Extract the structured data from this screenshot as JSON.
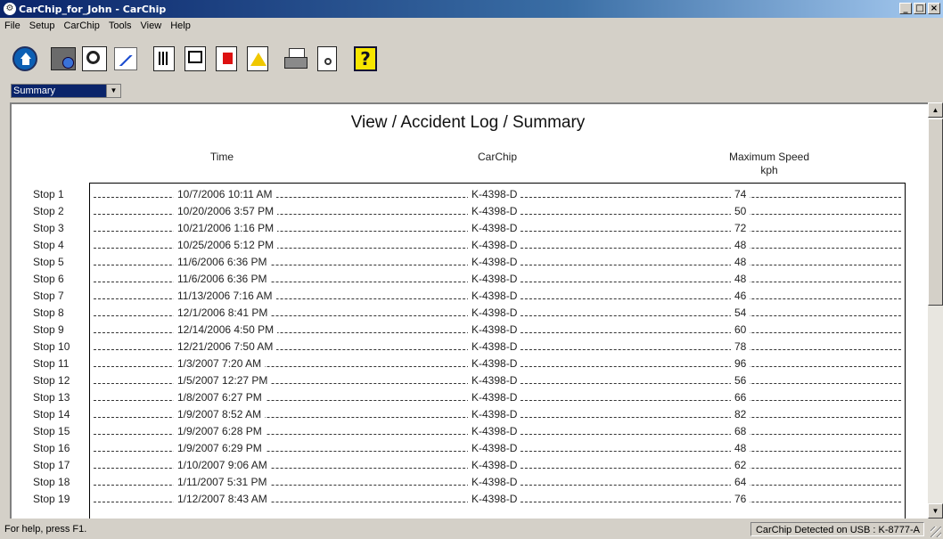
{
  "window": {
    "title": "CarChip_for_John - CarChip",
    "controls": [
      "_",
      "□",
      "×"
    ]
  },
  "menu": [
    "File",
    "Setup",
    "CarChip",
    "Tools",
    "View",
    "Help"
  ],
  "toolbar": {
    "icons": [
      "home-icon",
      "download-chip-icon",
      "view-data-icon",
      "graph-icon",
      "summary-report-icon",
      "window-report-icon",
      "add-report-icon",
      "warning-report-icon",
      "printer-icon",
      "print-preview-icon",
      "help-icon"
    ],
    "help_glyph": "?"
  },
  "view_selector": {
    "value": "Summary"
  },
  "report": {
    "title": "View / Accident Log / Summary",
    "col_time": "Time",
    "col_carchip": "CarChip",
    "col_speed": "Maximum Speed",
    "col_speed_unit": "kph",
    "rows": [
      {
        "stop": "Stop 1",
        "time": "10/7/2006 10:11 AM",
        "chip": "K-4398-D",
        "speed": "74"
      },
      {
        "stop": "Stop 2",
        "time": "10/20/2006 3:57 PM",
        "chip": "K-4398-D",
        "speed": "50"
      },
      {
        "stop": "Stop 3",
        "time": "10/21/2006 1:16 PM",
        "chip": "K-4398-D",
        "speed": "72"
      },
      {
        "stop": "Stop 4",
        "time": "10/25/2006 5:12 PM",
        "chip": "K-4398-D",
        "speed": "48"
      },
      {
        "stop": "Stop 5",
        "time": "11/6/2006 6:36 PM",
        "chip": "K-4398-D",
        "speed": "48"
      },
      {
        "stop": "Stop 6",
        "time": "11/6/2006 6:36 PM",
        "chip": "K-4398-D",
        "speed": "48"
      },
      {
        "stop": "Stop 7",
        "time": "11/13/2006 7:16 AM",
        "chip": "K-4398-D",
        "speed": "46"
      },
      {
        "stop": "Stop 8",
        "time": "12/1/2006 8:41 PM",
        "chip": "K-4398-D",
        "speed": "54"
      },
      {
        "stop": "Stop 9",
        "time": "12/14/2006 4:50 PM",
        "chip": "K-4398-D",
        "speed": "60"
      },
      {
        "stop": "Stop 10",
        "time": "12/21/2006 7:50 AM",
        "chip": "K-4398-D",
        "speed": "78"
      },
      {
        "stop": "Stop 11",
        "time": "1/3/2007 7:20 AM",
        "chip": "K-4398-D",
        "speed": "96"
      },
      {
        "stop": "Stop 12",
        "time": "1/5/2007 12:27 PM",
        "chip": "K-4398-D",
        "speed": "56"
      },
      {
        "stop": "Stop 13",
        "time": "1/8/2007 6:27 PM",
        "chip": "K-4398-D",
        "speed": "66"
      },
      {
        "stop": "Stop 14",
        "time": "1/9/2007 8:52 AM",
        "chip": "K-4398-D",
        "speed": "82"
      },
      {
        "stop": "Stop 15",
        "time": "1/9/2007 6:28 PM",
        "chip": "K-4398-D",
        "speed": "68"
      },
      {
        "stop": "Stop 16",
        "time": "1/9/2007 6:29 PM",
        "chip": "K-4398-D",
        "speed": "48"
      },
      {
        "stop": "Stop 17",
        "time": "1/10/2007 9:06 AM",
        "chip": "K-4398-D",
        "speed": "62"
      },
      {
        "stop": "Stop 18",
        "time": "1/11/2007 5:31 PM",
        "chip": "K-4398-D",
        "speed": "64"
      },
      {
        "stop": "Stop 19",
        "time": "1/12/2007 8:43 AM",
        "chip": "K-4398-D",
        "speed": "76"
      }
    ]
  },
  "status": {
    "left": "For help, press F1.",
    "right": "CarChip Detected on USB : K-8777-A"
  }
}
